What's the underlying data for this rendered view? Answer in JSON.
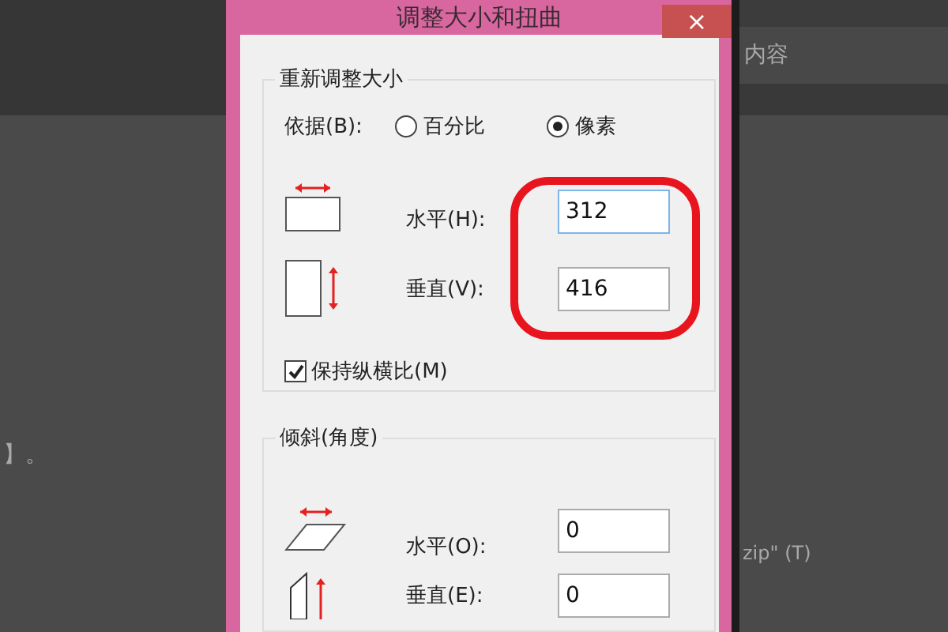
{
  "background": {
    "left_text": "】。",
    "right_tab": "内容",
    "right_text": "zip\" (T)"
  },
  "dialog": {
    "title": "调整大小和扭曲",
    "close": "×",
    "resize": {
      "title": "重新调整大小",
      "by_label": "依据(B):",
      "options": [
        {
          "label": "百分比",
          "selected": false
        },
        {
          "label": "像素",
          "selected": true
        }
      ],
      "fields": [
        {
          "kind": "horizontal",
          "label": "水平(H):",
          "value": "312"
        },
        {
          "kind": "vertical",
          "label": "垂直(V):",
          "value": "416"
        }
      ],
      "keep_ratio": {
        "label": "保持纵横比(M)",
        "checked": true
      }
    },
    "skew": {
      "title": "倾斜(角度)",
      "fields": [
        {
          "kind": "horizontal",
          "label": "水平(O):",
          "value": "0"
        },
        {
          "kind": "vertical",
          "label": "垂直(E):",
          "value": "0"
        }
      ]
    }
  }
}
